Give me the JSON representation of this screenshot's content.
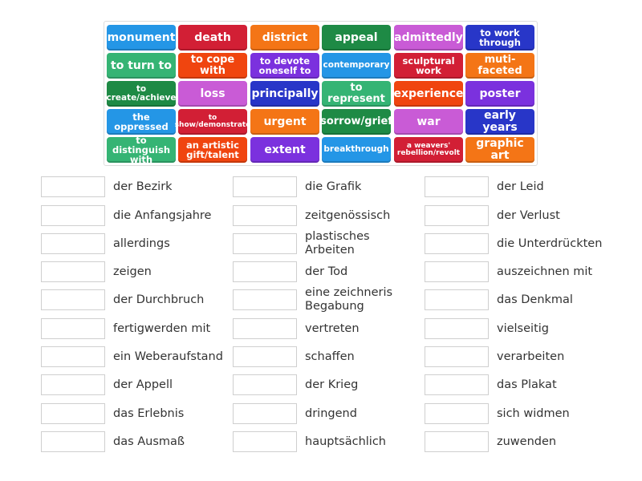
{
  "colors": {
    "blue": "#2496e6",
    "red": "#d21f35",
    "orange": "#f47516",
    "dark_green": "#1e8a45",
    "pink": "#c95bd6",
    "navy": "#2836c8",
    "green": "#35b474",
    "red_orange": "#f0450f",
    "purple": "#7b31de"
  },
  "tiles": [
    {
      "text": "monument",
      "color": "blue",
      "size": "xl"
    },
    {
      "text": "death",
      "color": "red",
      "size": "xl"
    },
    {
      "text": "district",
      "color": "orange",
      "size": "xl"
    },
    {
      "text": "appeal",
      "color": "dark_green",
      "size": "xl"
    },
    {
      "text": "admittedly",
      "color": "pink",
      "size": "xl"
    },
    {
      "text": "to work through",
      "color": "navy",
      "size": "m"
    },
    {
      "text": "to turn to",
      "color": "green",
      "size": "xl"
    },
    {
      "text": "to cope with",
      "color": "red_orange",
      "size": "l"
    },
    {
      "text": "to devote oneself to",
      "color": "purple",
      "size": "m"
    },
    {
      "text": "contemporary",
      "color": "blue",
      "size": "s"
    },
    {
      "text": "sculptural work",
      "color": "red",
      "size": "m"
    },
    {
      "text": "muti-faceted",
      "color": "orange",
      "size": "l"
    },
    {
      "text": "to create/achieve",
      "color": "dark_green",
      "size": "s"
    },
    {
      "text": "loss",
      "color": "pink",
      "size": "xl"
    },
    {
      "text": "principally",
      "color": "navy",
      "size": "xl"
    },
    {
      "text": "to represent",
      "color": "green",
      "size": "l"
    },
    {
      "text": "experience",
      "color": "red_orange",
      "size": "xl"
    },
    {
      "text": "poster",
      "color": "purple",
      "size": "xl"
    },
    {
      "text": "the oppressed",
      "color": "blue",
      "size": "m"
    },
    {
      "text": "to show/demonstrate",
      "color": "red",
      "size": "xs"
    },
    {
      "text": "urgent",
      "color": "orange",
      "size": "xl"
    },
    {
      "text": "sorrow/grief",
      "color": "dark_green",
      "size": "l"
    },
    {
      "text": "war",
      "color": "pink",
      "size": "xl"
    },
    {
      "text": "early years",
      "color": "navy",
      "size": "xl"
    },
    {
      "text": "to distinguish with",
      "color": "green",
      "size": "m"
    },
    {
      "text": "an artistic gift/talent",
      "color": "red_orange",
      "size": "m"
    },
    {
      "text": "extent",
      "color": "purple",
      "size": "xl"
    },
    {
      "text": "breakthrough",
      "color": "blue",
      "size": "s"
    },
    {
      "text": "a weavers' rebellion/revolt",
      "color": "red",
      "size": "xs"
    },
    {
      "text": "graphic art",
      "color": "orange",
      "size": "xl"
    }
  ],
  "columns": [
    [
      "der Bezirk",
      "die Anfangsjahre",
      "allerdings",
      "zeigen",
      "der Durchbruch",
      "fertigwerden mit",
      "ein Weberaufstand",
      "der Appell",
      "das Erlebnis",
      "das Ausmaß"
    ],
    [
      "die Grafik",
      "zeitgenössisch",
      "plastisches Arbeiten",
      "der Tod",
      "eine zeichneris Begabung",
      "vertreten",
      "schaffen",
      "der Krieg",
      "dringend",
      "hauptsächlich"
    ],
    [
      "der Leid",
      "der Verlust",
      "die Unterdrückten",
      "auszeichnen mit",
      "das Denkmal",
      "vielseitig",
      "verarbeiten",
      "das Plakat",
      "sich widmen",
      "zuwenden"
    ]
  ]
}
